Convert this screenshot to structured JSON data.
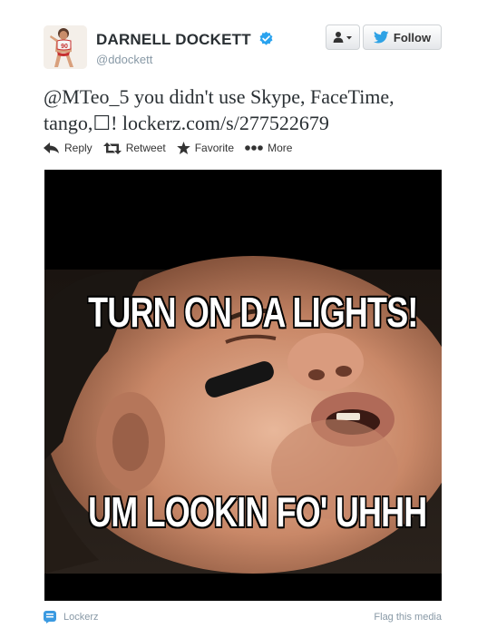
{
  "tweet": {
    "display_name": "DARNELL DOCKETT",
    "handle": "@ddockett",
    "jersey_number": "90",
    "text": "@MTeo_5 you didn't use Skype, FaceTime,\ntango,☐! lockerz.com/s/277522679"
  },
  "buttons": {
    "follow_label": "Follow"
  },
  "actions": {
    "reply": "Reply",
    "retweet": "Retweet",
    "favorite": "Favorite",
    "more": "More"
  },
  "media": {
    "caption_top": "TURN ON DA LIGHTS!",
    "caption_bottom": "UM LOOKIN FO' UHHH"
  },
  "footer": {
    "source": "Lockerz",
    "flag": "Flag this media"
  },
  "colors": {
    "verified": "#2aa3ef",
    "twitter_blue": "#2ea2e5",
    "source_icon": "#3b9ae1"
  },
  "icons": {
    "avatar": "avatar-image",
    "verified": "verified-badge-icon",
    "user": "user-icon",
    "bird": "twitter-bird-icon",
    "reply": "reply-icon",
    "retweet": "retweet-icon",
    "favorite": "star-icon",
    "more": "more-dots-icon",
    "source": "lockerz-icon"
  }
}
